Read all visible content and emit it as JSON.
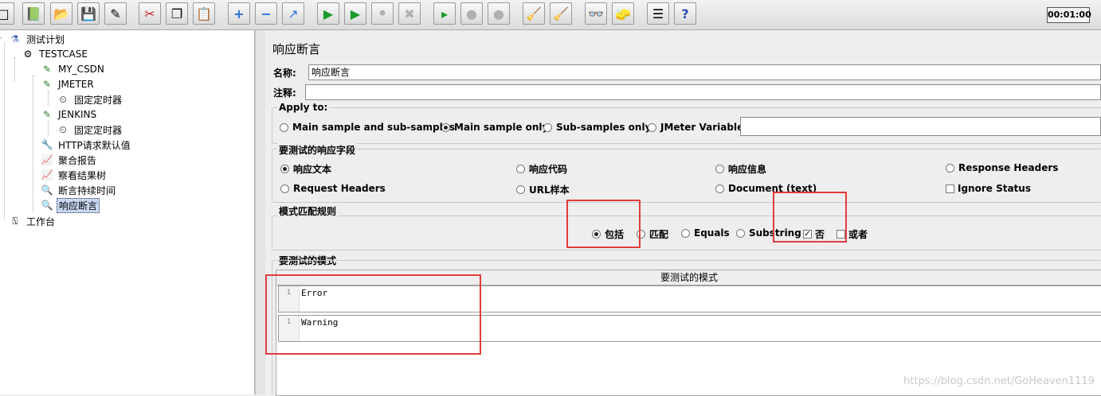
{
  "toolbar": {
    "buttons": [
      {
        "icon": "new-icon"
      },
      {
        "icon": "templates-icon"
      },
      {
        "icon": "open-icon"
      },
      {
        "icon": "save-icon"
      },
      {
        "icon": "save-as-icon"
      },
      {
        "icon": "cut-icon"
      },
      {
        "icon": "copy-icon"
      },
      {
        "icon": "paste-icon"
      },
      {
        "icon": "expand-icon"
      },
      {
        "icon": "collapse-icon"
      },
      {
        "icon": "toggle-icon"
      },
      {
        "icon": "start-icon"
      },
      {
        "icon": "start-no-pause-icon"
      },
      {
        "icon": "stop-icon"
      },
      {
        "icon": "shutdown-icon"
      },
      {
        "icon": "remote-start-icon"
      },
      {
        "icon": "remote-stop-icon"
      },
      {
        "icon": "remote-shutdown-icon"
      },
      {
        "icon": "clear-icon"
      },
      {
        "icon": "clear-all-icon"
      },
      {
        "icon": "search-icon"
      },
      {
        "icon": "reset-search-icon"
      },
      {
        "icon": "function-helper-icon"
      },
      {
        "icon": "help-icon"
      }
    ],
    "timer": "00:01:00"
  },
  "tree": {
    "test_plan": "测试计划",
    "thread_group": "TESTCASE",
    "items": [
      {
        "label": "MY_CSDN",
        "icon": "sampler-icon"
      },
      {
        "label": "JMETER",
        "icon": "sampler-icon"
      },
      {
        "label": "固定定时器",
        "icon": "timer-icon"
      },
      {
        "label": "JENKINS",
        "icon": "sampler-icon"
      },
      {
        "label": "固定定时器",
        "icon": "timer-icon"
      },
      {
        "label": "HTTP请求默认值",
        "icon": "config-icon"
      },
      {
        "label": "聚合报告",
        "icon": "listener-icon"
      },
      {
        "label": "察看结果树",
        "icon": "listener-icon"
      },
      {
        "label": "断言持续时间",
        "icon": "assertion-icon"
      },
      {
        "label": "响应断言",
        "icon": "assertion-icon",
        "selected": true
      }
    ],
    "workbench": "工作台"
  },
  "panel": {
    "title": "响应断言",
    "name_label": "名称:",
    "name_value": "响应断言",
    "comment_label": "注释:",
    "comment_value": "",
    "apply_to": {
      "title": "Apply to:",
      "options": [
        "Main sample and sub-samples",
        "Main sample only",
        "Sub-samples only",
        "JMeter Variable"
      ],
      "selected": "Main sample only",
      "variable_value": ""
    },
    "response_field": {
      "title": "要测试的响应字段",
      "row1": [
        "响应文本",
        "响应代码",
        "响应信息",
        "Response Headers"
      ],
      "row2": [
        "Request Headers",
        "URL样本",
        "Document (text)"
      ],
      "ignore_status": "Ignore Status",
      "selected": "响应文本"
    },
    "pattern_rules": {
      "title": "模式匹配规则",
      "options": [
        "包括",
        "匹配",
        "Equals",
        "Substring"
      ],
      "selected": "包括",
      "not_label": "否",
      "not_checked": true,
      "or_label": "或者",
      "or_checked": false
    },
    "patterns": {
      "title": "要测试的模式",
      "column_header": "要测试的模式",
      "rows": [
        {
          "line": "1",
          "text": "Error"
        },
        {
          "line": "1",
          "text": "Warning"
        }
      ]
    }
  },
  "watermark": "https://blog.csdn.net/GoHeaven1119"
}
